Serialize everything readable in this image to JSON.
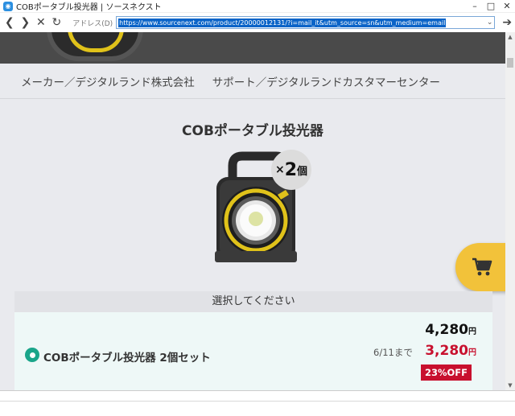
{
  "window": {
    "title": "COBポータブル投光器 | ソースネクスト",
    "minimize": "–",
    "maximize": "□",
    "close": "✕"
  },
  "address_bar": {
    "label": "アドレス(D)",
    "url": "https://www.sourcenext.com/product/20000012131/?i=mail_it&utm_source=sn&utm_medium=email"
  },
  "maker_bar": {
    "maker": "メーカー／デジタルランド株式会社",
    "support": "サポート／デジタルランドカスタマーセンター"
  },
  "product": {
    "title": "COBポータブル投光器",
    "badge": "×2個",
    "badge_prefix": "×",
    "badge_num": "2",
    "badge_unit": "個"
  },
  "selection": {
    "header": "選択してください",
    "options": [
      {
        "label": "COBポータブル投光器 2個セット",
        "deadline": "6/11まで",
        "original_price": "4,280",
        "sale_price": "3,280",
        "currency": "円",
        "discount": "23%OFF"
      }
    ]
  },
  "icons": {
    "cart": "cart-icon",
    "back": "arrow-left-icon",
    "forward": "arrow-right-icon",
    "stop": "close-icon",
    "reload": "reload-icon",
    "go": "arrow-right-icon"
  },
  "colors": {
    "accent_red": "#c8102e",
    "cart_yellow": "#f2c23a",
    "radio_green": "#1aa58a",
    "lamp_yellow": "#e0c21a"
  }
}
